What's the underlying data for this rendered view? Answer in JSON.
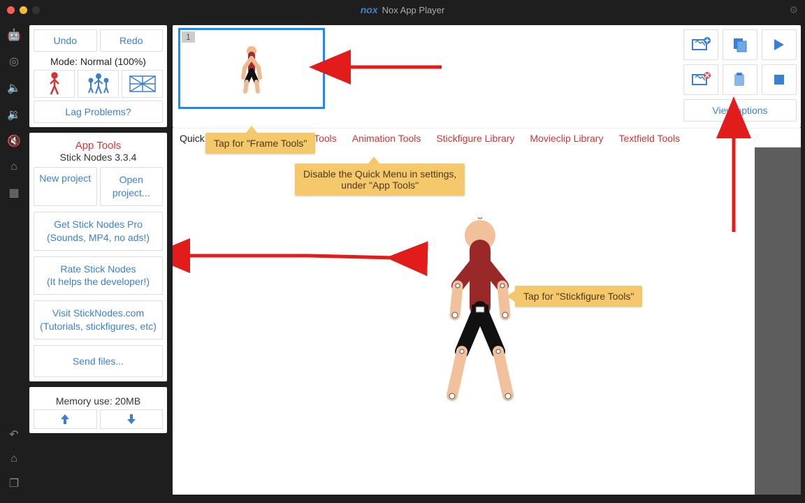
{
  "titlebar": {
    "logo": "nox",
    "title": "Nox App Player"
  },
  "sidebar": {
    "undo": "Undo",
    "redo": "Redo",
    "mode_line": "Mode: Normal (100%)",
    "lag_problems": "Lag Problems?"
  },
  "app_tools": {
    "heading": "App Tools",
    "version": "Stick Nodes 3.3.4",
    "new_project": "New project",
    "open_project": "Open project...",
    "get_pro_l1": "Get Stick Nodes Pro",
    "get_pro_l2": "(Sounds, MP4, no ads!)",
    "rate_l1": "Rate Stick Nodes",
    "rate_l2": "(It helps the developer!)",
    "visit_l1": "Visit StickNodes.com",
    "visit_l2": "(Tutorials, stickfigures, etc)",
    "send_files": "Send files...",
    "memory": "Memory use: 20MB"
  },
  "timeline": {
    "frame1_number": "1",
    "view_options": "View options"
  },
  "menu": {
    "quick": "Quick",
    "project_tools": "ect Tools",
    "animation_tools": "Animation Tools",
    "stickfigure_library": "Stickfigure Library",
    "movieclip_library": "Movieclip Library",
    "textfield_tools": "Textfield Tools"
  },
  "callouts": {
    "frame_tools": "Tap for \"Frame Tools\"",
    "disable_quick_l1": "Disable the Quick Menu in settings,",
    "disable_quick_l2": "under \"App Tools\"",
    "stickfigure_tools": "Tap for \"Stickfigure Tools\""
  }
}
